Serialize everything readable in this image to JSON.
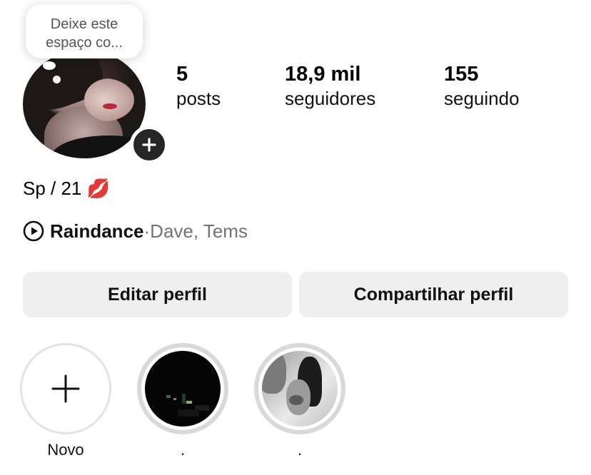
{
  "profile": {
    "tooltip": {
      "line1": "Deixe este",
      "line2": "espaço co..."
    },
    "stats": [
      {
        "value": "5",
        "label": "posts"
      },
      {
        "value": "18,9 mil",
        "label": "seguidores"
      },
      {
        "value": "155",
        "label": "seguindo"
      }
    ],
    "bio": "Sp / 21 💋",
    "music": {
      "song": "Raindance",
      "separator": " · ",
      "artists": "Dave, Tems"
    }
  },
  "actions": {
    "edit_label": "Editar perfil",
    "share_label": "Compartilhar perfil"
  },
  "highlights": [
    {
      "label": "Novo",
      "icon": "plus-icon"
    },
    {
      "label": "."
    },
    {
      "label": "."
    }
  ],
  "icons": {
    "add_story": "plus-icon",
    "music": "play-circle-icon"
  },
  "colors": {
    "button_bg": "#efeff0",
    "muted_text": "#737373",
    "badge_bg": "#262626"
  }
}
